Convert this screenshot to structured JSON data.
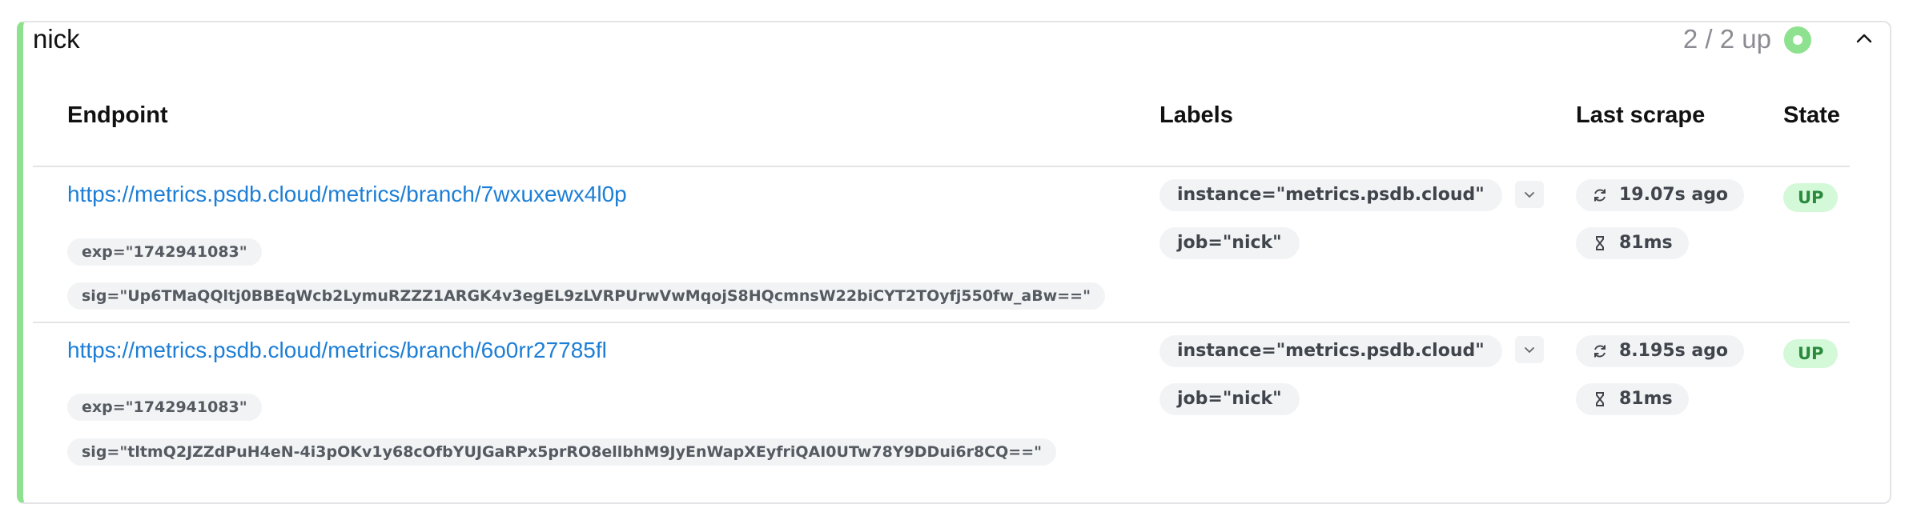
{
  "pool": {
    "title": "nick",
    "summary": "2 / 2 up",
    "health_color": "#8ee28f"
  },
  "table": {
    "headers": {
      "endpoint": "Endpoint",
      "labels": "Labels",
      "last_scrape": "Last scrape",
      "state": "State"
    },
    "rows": [
      {
        "url": "https://metrics.psdb.cloud/metrics/branch/7wxuxewx4l0p",
        "params": [
          "exp=\"1742941083\"",
          "sig=\"Up6TMaQQltj0BBEqWcb2LymuRZZZ1ARGK4v3egEL9zLVRPUrwVwMqojS8HQcmnsW22biCYT2TOyfj550fw_aBw==\""
        ],
        "labels": [
          "instance=\"metrics.psdb.cloud\"",
          "job=\"nick\""
        ],
        "last_scrape": "19.07s ago",
        "duration": "81ms",
        "state": "UP"
      },
      {
        "url": "https://metrics.psdb.cloud/metrics/branch/6o0rr27785fl",
        "params": [
          "exp=\"1742941083\"",
          "sig=\"tltmQ2JZZdPuH4eN-4i3pOKv1y68cOfbYUJGaRPx5prRO8ellbhM9JyEnWapXEyfriQAI0UTw78Y9DDui6r8CQ==\""
        ],
        "labels": [
          "instance=\"metrics.psdb.cloud\"",
          "job=\"nick\""
        ],
        "last_scrape": "8.195s ago",
        "duration": "81ms",
        "state": "UP"
      }
    ]
  }
}
